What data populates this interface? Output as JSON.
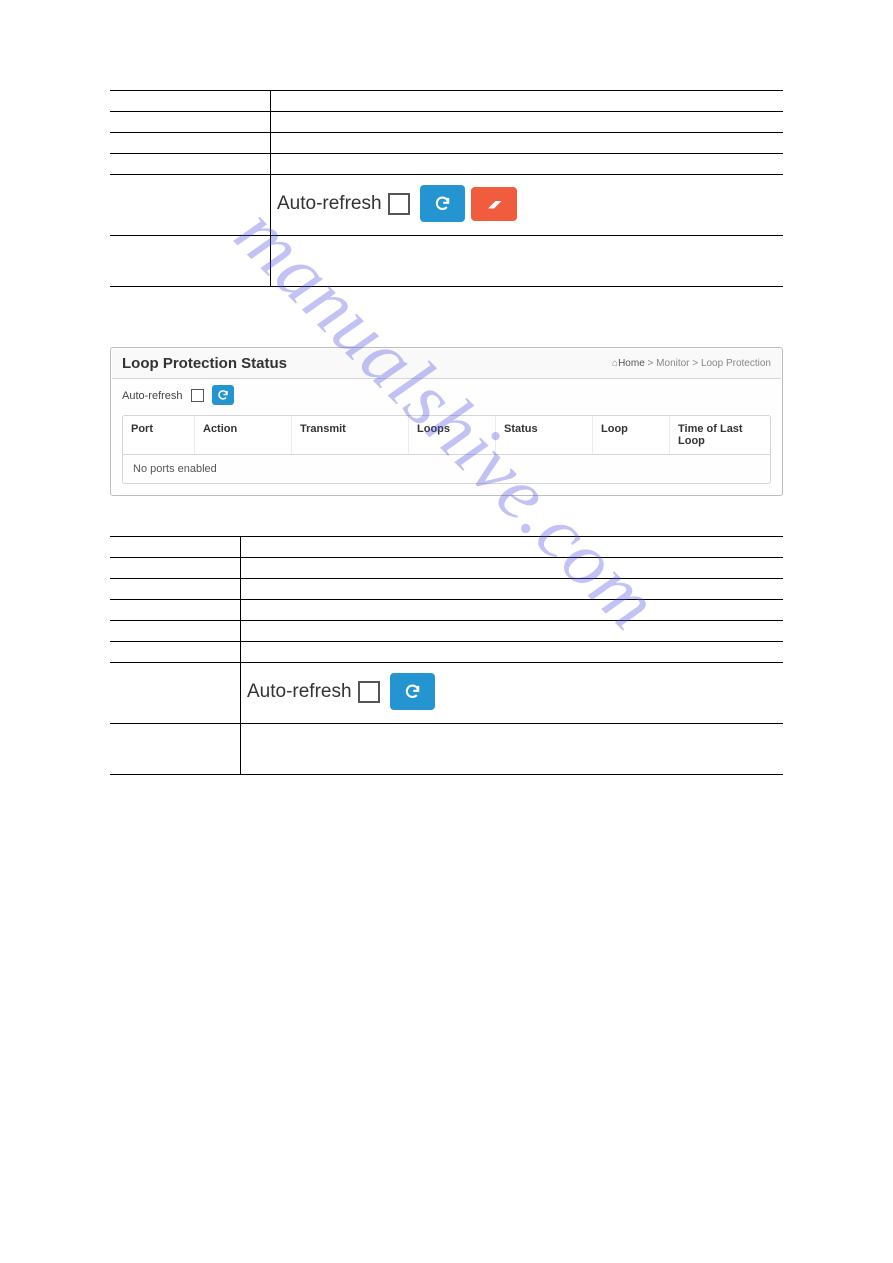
{
  "watermark": "manualshive.com",
  "section1": {
    "auto_refresh_label": "Auto-refresh"
  },
  "panel": {
    "title": "Loop Protection Status",
    "breadcrumb": {
      "home": "Home",
      "a": "Monitor",
      "b": "Loop Protection",
      "sep": ">"
    },
    "auto_refresh_label": "Auto-refresh",
    "columns": [
      "Port",
      "Action",
      "Transmit",
      "Loops",
      "Status",
      "Loop",
      "Time of Last Loop"
    ],
    "empty_row": "No ports enabled"
  },
  "section2": {
    "auto_refresh_label": "Auto-refresh"
  }
}
